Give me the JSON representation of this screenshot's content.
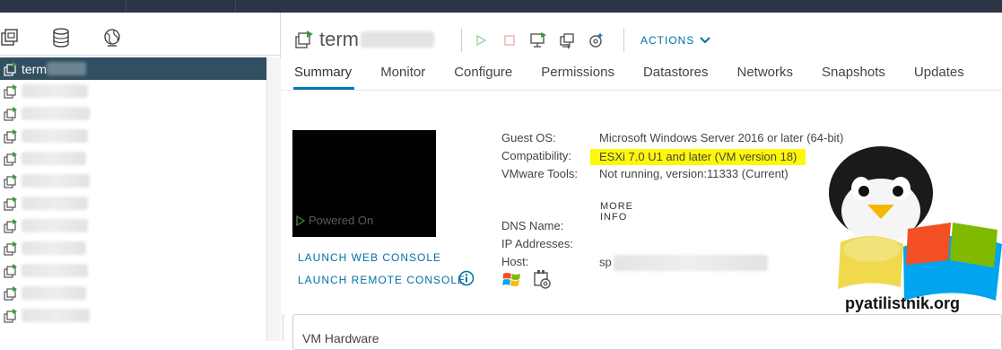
{
  "vm": {
    "name": "term",
    "actions_label": "ACTIONS"
  },
  "tabs": [
    "Summary",
    "Monitor",
    "Configure",
    "Permissions",
    "Datastores",
    "Networks",
    "Snapshots",
    "Updates"
  ],
  "active_tab": "Summary",
  "nav": {
    "selected_name": "term",
    "item_count": 12
  },
  "console": {
    "power_state": "Powered On",
    "launch_web": "LAUNCH WEB CONSOLE",
    "launch_remote": "LAUNCH REMOTE CONSOLE"
  },
  "info": {
    "guest_os_label": "Guest OS:",
    "guest_os_value": "Microsoft Windows Server 2016 or later (64-bit)",
    "compat_label": "Compatibility:",
    "compat_value": "ESXi 7.0 U1 and later (VM version 18)",
    "tools_label": "VMware Tools:",
    "tools_value": "Not running, version:11333 (Current)",
    "more_info": "MORE INFO",
    "dns_label": "DNS Name:",
    "ip_label": "IP Addresses:",
    "host_label": "Host:",
    "host_value": "sp"
  },
  "hardware": {
    "title": "VM Hardware"
  },
  "watermark": {
    "text": "pyatilistnik.org"
  },
  "colors": {
    "accent": "#0079b8",
    "link": "#0072a3",
    "highlight": "#fff70a",
    "selected_row": "#324f61",
    "topbar": "#2a3545"
  }
}
